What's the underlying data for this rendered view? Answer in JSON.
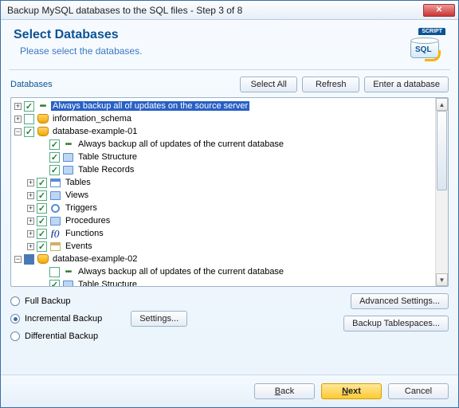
{
  "title": "Backup MySQL databases to the SQL files - Step 3 of 8",
  "header": {
    "title": "Select Databases",
    "subtitle": "Please select the databases.",
    "badge": "SCRIPT",
    "sql": "SQL"
  },
  "section_label": "Databases",
  "buttons": {
    "select_all": "Select All",
    "refresh": "Refresh",
    "enter_db": "Enter a database",
    "advanced": "Advanced Settings...",
    "tablespaces": "Backup Tablespaces...",
    "settings": "Settings...",
    "back": "Back",
    "next": "Next",
    "cancel": "Cancel"
  },
  "tree": {
    "root_always": "Always backup all of updates on the source server",
    "info_schema": "information_schema",
    "db1": {
      "name": "database-example-01",
      "always": "Always backup all of updates of the current database",
      "table_structure": "Table Structure",
      "table_records": "Table Records",
      "tables": "Tables",
      "views": "Views",
      "triggers": "Triggers",
      "procedures": "Procedures",
      "functions": "Functions",
      "events": "Events"
    },
    "db2": {
      "name": "database-example-02",
      "always": "Always backup all of updates of the current database",
      "table_structure": "Table Structure"
    }
  },
  "backup_mode": {
    "full": "Full Backup",
    "incremental": "Incremental Backup",
    "differential": "Differential Backup"
  },
  "icons": {
    "fn": "f()"
  }
}
